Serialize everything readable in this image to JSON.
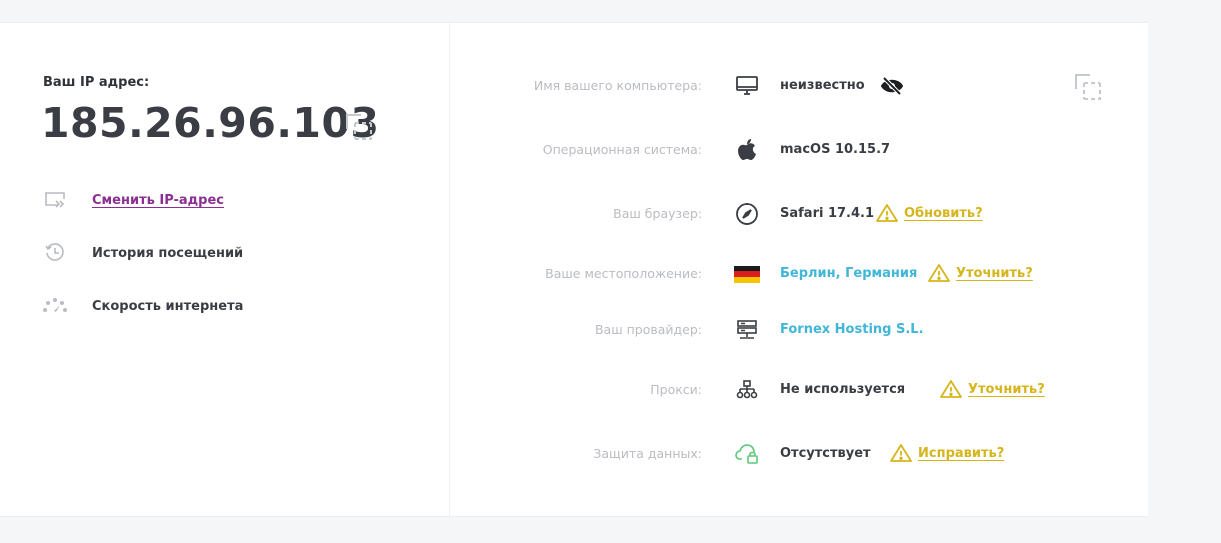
{
  "ip": {
    "label": "Ваш IP адрес:",
    "value": "185.26.96.103"
  },
  "left_menu": [
    {
      "label": "Сменить IP-адрес",
      "icon": "change-ip-icon",
      "link": true
    },
    {
      "label": "История посещений",
      "icon": "history-icon",
      "link": false
    },
    {
      "label": "Скорость интернета",
      "icon": "speedometer-icon",
      "link": false
    }
  ],
  "details": [
    {
      "label": "Имя вашего компьютера:",
      "icon": "monitor-icon",
      "value": "неизвестно"
    },
    {
      "label": "Операционная система:",
      "icon": "apple-icon",
      "value": "macOS 10.15.7"
    },
    {
      "label": "Ваш браузер:",
      "icon": "compass-icon",
      "value": "Safari 17.4.1",
      "action": "Обновить?"
    },
    {
      "label": "Ваше местоположение:",
      "icon": "germany-flag-icon",
      "value": "Берлин, Германия",
      "action": "Уточнить?"
    },
    {
      "label": "Ваш провайдер:",
      "icon": "server-icon",
      "value": "Fornex Hosting S.L."
    },
    {
      "label": "Прокси:",
      "icon": "network-icon",
      "value": "Не используется",
      "action": "Уточнить?"
    },
    {
      "label": "Защита данных:",
      "icon": "cloud-lock-icon",
      "value": "Отсутствует",
      "action": "Исправить?"
    }
  ],
  "colors": {
    "link_purple": "#8b2f92",
    "value_blue": "#40b6d8",
    "warning_yellow": "#d6b51c",
    "cloud_green": "#5cc87a"
  }
}
